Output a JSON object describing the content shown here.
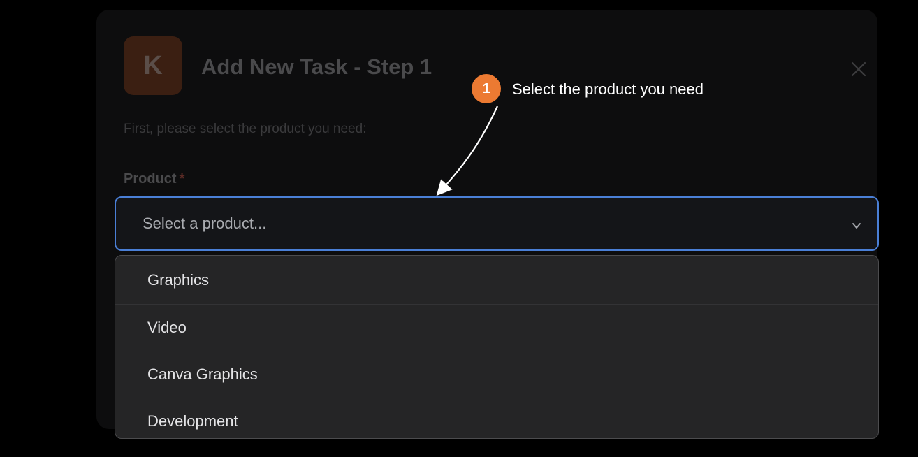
{
  "modal": {
    "logo_letter": "K",
    "title": "Add New Task - Step 1",
    "subtitle": "First, please select the product you need:",
    "field_label": "Product",
    "required_mark": "*"
  },
  "select": {
    "placeholder": "Select a product...",
    "options": [
      {
        "label": "Graphics"
      },
      {
        "label": "Video"
      },
      {
        "label": "Canva Graphics"
      },
      {
        "label": "Development"
      }
    ]
  },
  "callout": {
    "step_number": "1",
    "text": "Select the product you need"
  },
  "colors": {
    "accent_orange": "#ec7a32",
    "focus_blue": "#4a7fd6",
    "dropdown_bg": "#252526"
  },
  "icons": {
    "close": "close-icon",
    "chevron": "chevron-down-icon"
  }
}
